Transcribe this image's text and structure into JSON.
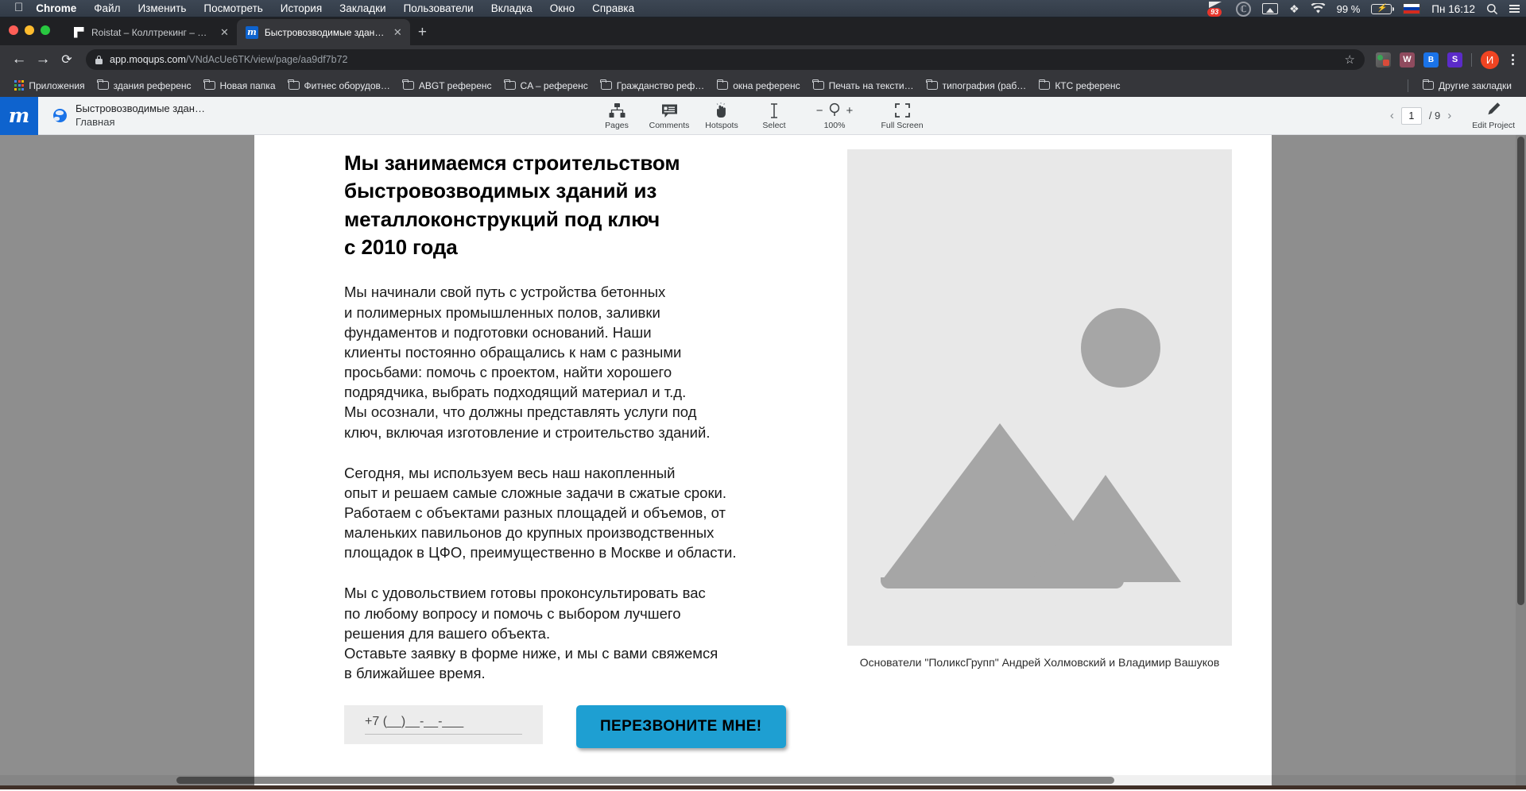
{
  "macos_menubar": {
    "apple_icon": "apple-logo-icon",
    "items": [
      {
        "label": "Chrome",
        "bold": true
      },
      {
        "label": "Файл",
        "bold": false
      },
      {
        "label": "Изменить",
        "bold": false
      },
      {
        "label": "Посмотреть",
        "bold": false
      },
      {
        "label": "История",
        "bold": false
      },
      {
        "label": "Закладки",
        "bold": false
      },
      {
        "label": "Пользователи",
        "bold": false
      },
      {
        "label": "Вкладка",
        "bold": false
      },
      {
        "label": "Окно",
        "bold": false
      },
      {
        "label": "Справка",
        "bold": false
      }
    ],
    "status": {
      "notification_badge": "93",
      "creative_cloud_icon": "creative-cloud-icon",
      "airplay_icon": "airplay-icon",
      "bluetooth_icon": "bluetooth-icon",
      "wifi_icon": "wifi-icon",
      "battery_percent": "99 %",
      "battery_icon": "battery-charging-icon",
      "input_language": "RU",
      "clock": "Пн 16:12",
      "spotlight_icon": "search-icon",
      "control_center_icon": "control-center-icon"
    }
  },
  "browser": {
    "tabs": [
      {
        "title": "Roistat – Коллтрекинг – Истор",
        "favicon": "roistat-favicon",
        "active": false
      },
      {
        "title": "Быстровозводимые здания (П",
        "favicon": "moqups-favicon",
        "active": true
      }
    ],
    "new_tab_label": "+",
    "close_glyph": "✕",
    "nav": {
      "back": "←",
      "forward": "→",
      "reload": "⟳"
    },
    "omnibox": {
      "lock_icon": "lock-icon",
      "host": "app.moqups.com",
      "path": "/VNdAcUe6TK/view/page/aa9df7b72",
      "bookmark_star": "☆"
    },
    "extensions": [
      {
        "name": "prisma-extension",
        "label": ""
      },
      {
        "name": "wordtune-extension",
        "label": "W"
      },
      {
        "name": "bitly-extension",
        "label": "B"
      },
      {
        "name": "grammar-extension",
        "label": "S"
      }
    ],
    "profile_initial": "И",
    "menu_icon": "kebab-menu-icon",
    "bookmarks": [
      {
        "label": "Приложения",
        "icon": "apps-grid-icon"
      },
      {
        "label": "здания референс",
        "icon": "folder-icon"
      },
      {
        "label": "Новая папка",
        "icon": "folder-icon"
      },
      {
        "label": "Фитнес оборудов…",
        "icon": "folder-icon"
      },
      {
        "label": "ABGT референс",
        "icon": "folder-icon"
      },
      {
        "label": "CA – референс",
        "icon": "folder-icon"
      },
      {
        "label": "Гражданство реф…",
        "icon": "folder-icon"
      },
      {
        "label": "окна референс",
        "icon": "folder-icon"
      },
      {
        "label": "Печать на тексти…",
        "icon": "folder-icon"
      },
      {
        "label": "типография (раб…",
        "icon": "folder-icon"
      },
      {
        "label": "КТС референс",
        "icon": "folder-icon"
      }
    ],
    "other_bookmarks": {
      "label": "Другие закладки",
      "icon": "folder-icon"
    }
  },
  "app": {
    "logo_letter": "m",
    "project_name": "Быстровозводимые здан…",
    "page_name": "Главная",
    "share_icon": "globe-icon",
    "tools": [
      {
        "label": "Pages",
        "icon": "pages-icon"
      },
      {
        "label": "Comments",
        "icon": "comment-icon"
      },
      {
        "label": "Hotspots",
        "icon": "hand-pointer-icon"
      },
      {
        "label": "Select",
        "icon": "text-cursor-icon"
      }
    ],
    "zoom": {
      "minus": "−",
      "plus": "+",
      "level": "100%",
      "icon": "magnifier-icon"
    },
    "fullscreen": {
      "label": "Full Screen",
      "icon": "fullscreen-icon"
    },
    "pager": {
      "prev": "‹",
      "next": "›",
      "current": "1",
      "separator": "/ 9",
      "total": "9"
    },
    "edit_project": {
      "label": "Edit Project",
      "icon": "pencil-icon"
    }
  },
  "mockup": {
    "heading_lines": [
      "Мы занимаемся строительством",
      "быстровозводимых зданий из",
      "металлоконструкций под ключ"
    ],
    "heading_year": "с 2010 года",
    "paragraph1": [
      "Мы начинали свой путь с устройства бетонных",
      "и полимерных промышленных полов, заливки",
      "фундаментов и подготовки оснований. Наши",
      "клиенты постоянно обращались к нам с разными",
      "просьбами: помочь с проектом, найти хорошего",
      "подрядчика, выбрать подходящий материал и т.д.",
      "Мы осознали, что должны представлять услуги под",
      "ключ, включая изготовление и строительство зданий."
    ],
    "paragraph2": [
      "Сегодня, мы используем весь наш накопленный",
      "опыт и решаем самые сложные задачи в сжатые сроки.",
      "Работаем с объектами разных площадей и объемов, от",
      "маленьких павильонов до крупных производственных",
      "площадок в ЦФО, преимущественно в Москве и области."
    ],
    "paragraph3": [
      "Мы с удовольствием готовы проконсультировать вас",
      "по любому вопросу и помочь с выбором лучшего",
      "решения для вашего объекта.",
      "Оставьте заявку в форме ниже, и мы с вами свяжемся",
      "в ближайшее время."
    ],
    "phone_placeholder": "+7 (__)__-__-___",
    "phone_value": "",
    "cta_label": "ПЕРЕЗВОНИТЕ МНЕ!",
    "image_placeholder_icon": "image-placeholder-icon",
    "image_caption": "Основатели \"ПоликсГрупп\" Андрей Холмовский и Владимир Вашуков",
    "colors": {
      "cta": "#1e9fd2",
      "placeholder_bg": "#e8e8e8",
      "placeholder_shape": "#a6a6a6"
    }
  }
}
